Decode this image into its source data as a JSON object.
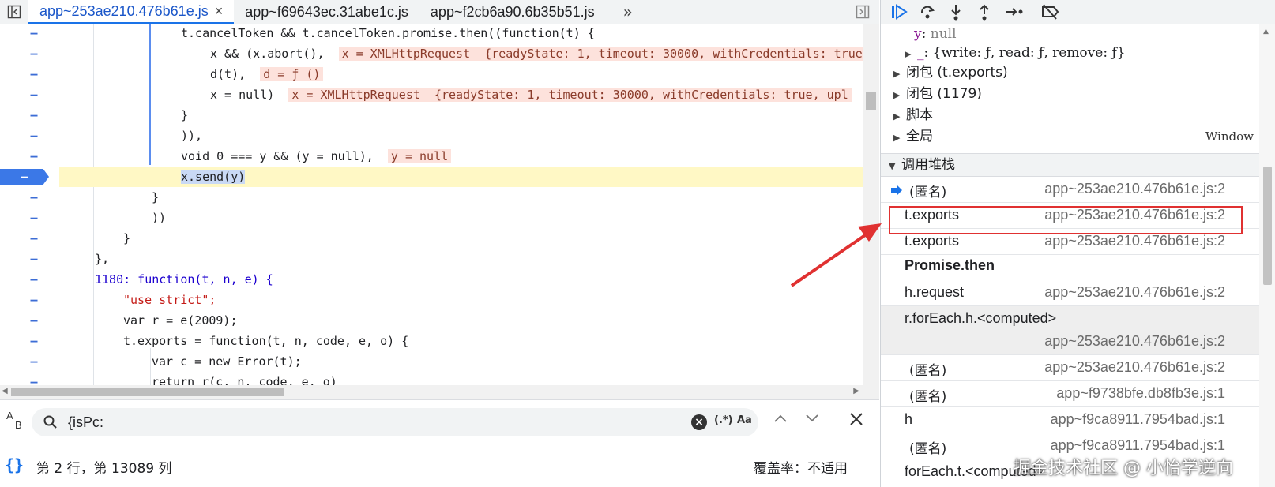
{
  "editor": {
    "tabs": [
      {
        "label": "app~253ae210.476b61e.js",
        "active": true
      },
      {
        "label": "app~f69643ec.31abe1c.js",
        "active": false
      },
      {
        "label": "app~f2cb6a90.6b35b51.js",
        "active": false
      }
    ],
    "tab_close": "×",
    "gutter_mark": "–",
    "lines": [
      {
        "code": "t.cancelToken && t.cancelToken.promise.then((function(t) {"
      },
      {
        "code": "x && (x.abort(),",
        "inline": "x = XMLHttpRequest  {readyState: 1, timeout: 30000, withCredentials: true, upl"
      },
      {
        "code": "d(t),",
        "inline": "d = ƒ ()"
      },
      {
        "code": "x = null)",
        "inline": "x = XMLHttpRequest  {readyState: 1, timeout: 30000, withCredentials: true, upl"
      },
      {
        "code": "}"
      },
      {
        "code": ")),"
      },
      {
        "code": "void 0 === y && (y = null),",
        "inline": "y = null"
      },
      {
        "code": "x.send(y)",
        "paused": true
      },
      {
        "code": "}"
      },
      {
        "code": "))"
      },
      {
        "code": "}"
      },
      {
        "code": "},"
      },
      {
        "code": "1180: function(t, n, e) {"
      },
      {
        "code": "\"use strict\";"
      },
      {
        "code": "var r = e(2009);"
      },
      {
        "code": "t.exports = function(t, n, code, e, o) {"
      },
      {
        "code": "var c = new Error(t);"
      },
      {
        "code": "return r(c, n, code, e, o)"
      }
    ]
  },
  "search": {
    "ab_label_top": "A",
    "ab_label_bottom": "B",
    "query": "{isPc:",
    "regex_label": "(.*)",
    "case_label": "Aa"
  },
  "status": {
    "braces": "{}",
    "position": "第 2 行，第 13089 列",
    "coverage": "覆盖率：不适用"
  },
  "scope": {
    "y_key": "y",
    "y_val": "null",
    "underscore_key": "_",
    "underscore_val": "{write: ƒ, read: ƒ, remove: ƒ}",
    "closure1": "闭包 (t.exports)",
    "closure2": "闭包 (1179)",
    "script": "脚本",
    "global": "全局",
    "global_value": "Window"
  },
  "call_stack": {
    "header": "调用堆栈",
    "frames": [
      {
        "fn": "(匿名)",
        "loc": "app~253ae210.476b61e.js:2"
      },
      {
        "fn": "t.exports",
        "loc": "app~253ae210.476b61e.js:2"
      },
      {
        "fn": "t.exports",
        "loc": "app~253ae210.476b61e.js:2"
      },
      {
        "fn": "h.request",
        "loc": "app~253ae210.476b61e.js:2"
      },
      {
        "fn": "r.forEach.h.<computed>",
        "loc": "app~253ae210.476b61e.js:2"
      },
      {
        "fn": "(匿名)",
        "loc": "app~253ae210.476b61e.js:2"
      },
      {
        "fn": "(匿名)",
        "loc": "app~f9738bfe.db8fb3e.js:1"
      },
      {
        "fn": "h",
        "loc": "app~f9ca8911.7954bad.js:1"
      },
      {
        "fn": "(匿名)",
        "loc": "app~f9ca8911.7954bad.js:1"
      },
      {
        "fn": "forEach.t.<computed>",
        "loc": ""
      }
    ],
    "async_label": "Promise.then"
  },
  "watermark": "掘金技术社区 @ 小怡学逆向",
  "colors": {
    "accent": "#1a73e8",
    "paused_line": "#fff8c5",
    "inline_value_bg": "#fde2dc",
    "annotation_red": "#e03131"
  }
}
